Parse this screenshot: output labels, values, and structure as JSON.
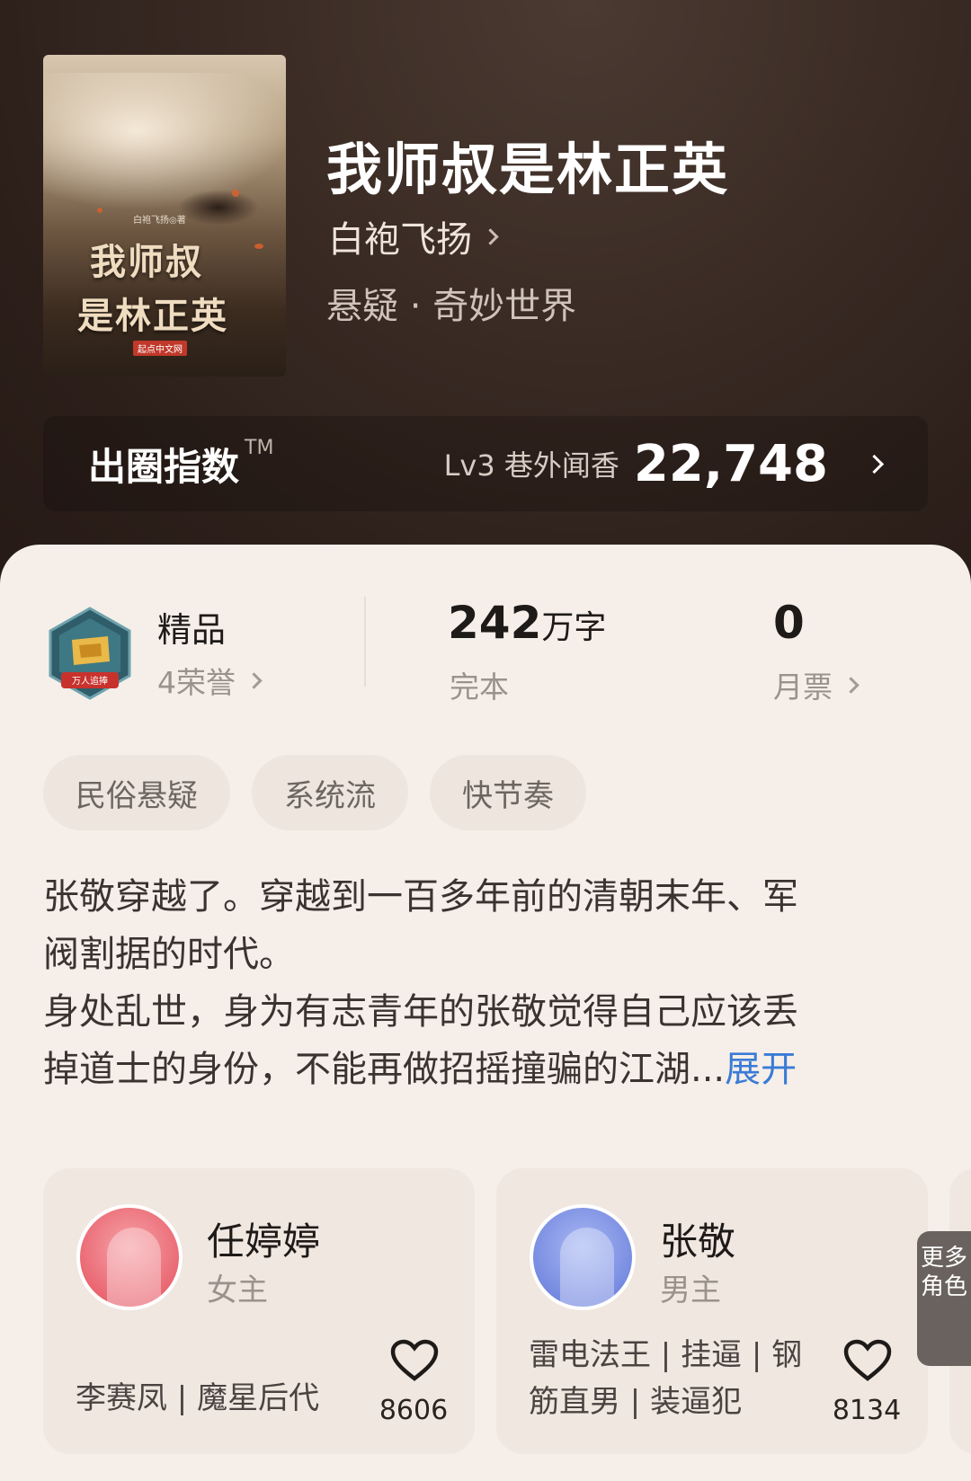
{
  "book": {
    "cover": {
      "author_tag": "白袍飞扬◎著",
      "title_line1": "我师叔",
      "title_line2": "是林正英",
      "publisher": "起点中文网"
    },
    "title": "我师叔是林正英",
    "author": "白袍飞扬",
    "genre": "悬疑 · 奇妙世界"
  },
  "index": {
    "title": "出圈指数",
    "tm": "TM",
    "level": "Lv3 巷外闻香",
    "value": "22,748"
  },
  "stats": {
    "quality": {
      "label": "精品",
      "honors": "4荣誉",
      "badge_text": "万人追捧"
    },
    "words": {
      "value": "242",
      "unit": "万字",
      "status": "完本"
    },
    "tickets": {
      "value": "0",
      "label": "月票"
    }
  },
  "tags": [
    "民俗悬疑",
    "系统流",
    "快节奏"
  ],
  "description": {
    "line1": "张敬穿越了。穿越到一百多年前的清朝末年、军",
    "line2": "阀割据的时代。",
    "line3": "身处乱世，身为有志青年的张敬觉得自己应该丢",
    "line4": "掉道士的身份，不能再做招摇撞骗的江湖...",
    "expand": "展开"
  },
  "characters": [
    {
      "name": "任婷婷",
      "role": "女主",
      "traits": "李赛凤 | 魔星后代",
      "likes": "8606"
    },
    {
      "name": "张敬",
      "role": "男主",
      "traits": "雷电法王 | 挂逼 | 钢筋直男 | 装逼犯",
      "likes": "8134"
    }
  ],
  "more_roles": "更多角色",
  "colors": {
    "accent": "#3a7bd5",
    "header_bg": "#2c1f1a",
    "card_bg": "#f6efe9"
  }
}
